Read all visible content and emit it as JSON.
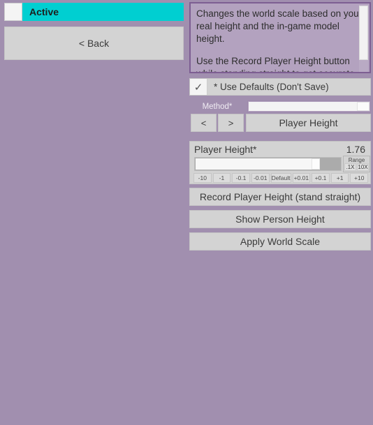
{
  "left": {
    "active_checkbox": {
      "name": "active-checkbox",
      "checked": false
    },
    "active_label": "Active",
    "back_button": "< Back"
  },
  "description": {
    "paragraph_1": "Changes the world scale based on your real height and the in-game model height.",
    "paragraph_2": "Use the Record Player Height button while standing straight to get accurate",
    "scrollbar": "vertical-scrollbar"
  },
  "use_defaults": {
    "checkmark": "✓",
    "label": "* Use Defaults (Don't Save)",
    "checked": true
  },
  "method": {
    "label": "Method*",
    "prev_button": "<",
    "next_button": ">",
    "value": "Player Height",
    "slider_fill_percent": 88
  },
  "player_height": {
    "title": "Player Height*",
    "value": "1.76",
    "slider_fill_percent": 79,
    "range": {
      "title": "Range",
      "buttons": [
        "1X",
        "10X"
      ]
    },
    "steps": [
      "-10",
      "-1",
      "-0.1",
      "-0.01",
      "Default",
      "+0.01",
      "+0.1",
      "+1",
      "+10"
    ]
  },
  "actions": [
    "Record Player Height (stand straight)",
    "Show Person Height",
    "Apply World Scale"
  ],
  "colors": {
    "background": "#a18faf",
    "accent_cyan": "#00cfd1",
    "control_gray": "#d3d3d3",
    "panel_purple": "#b3a2bf",
    "panel_border": "#7d5e92"
  }
}
